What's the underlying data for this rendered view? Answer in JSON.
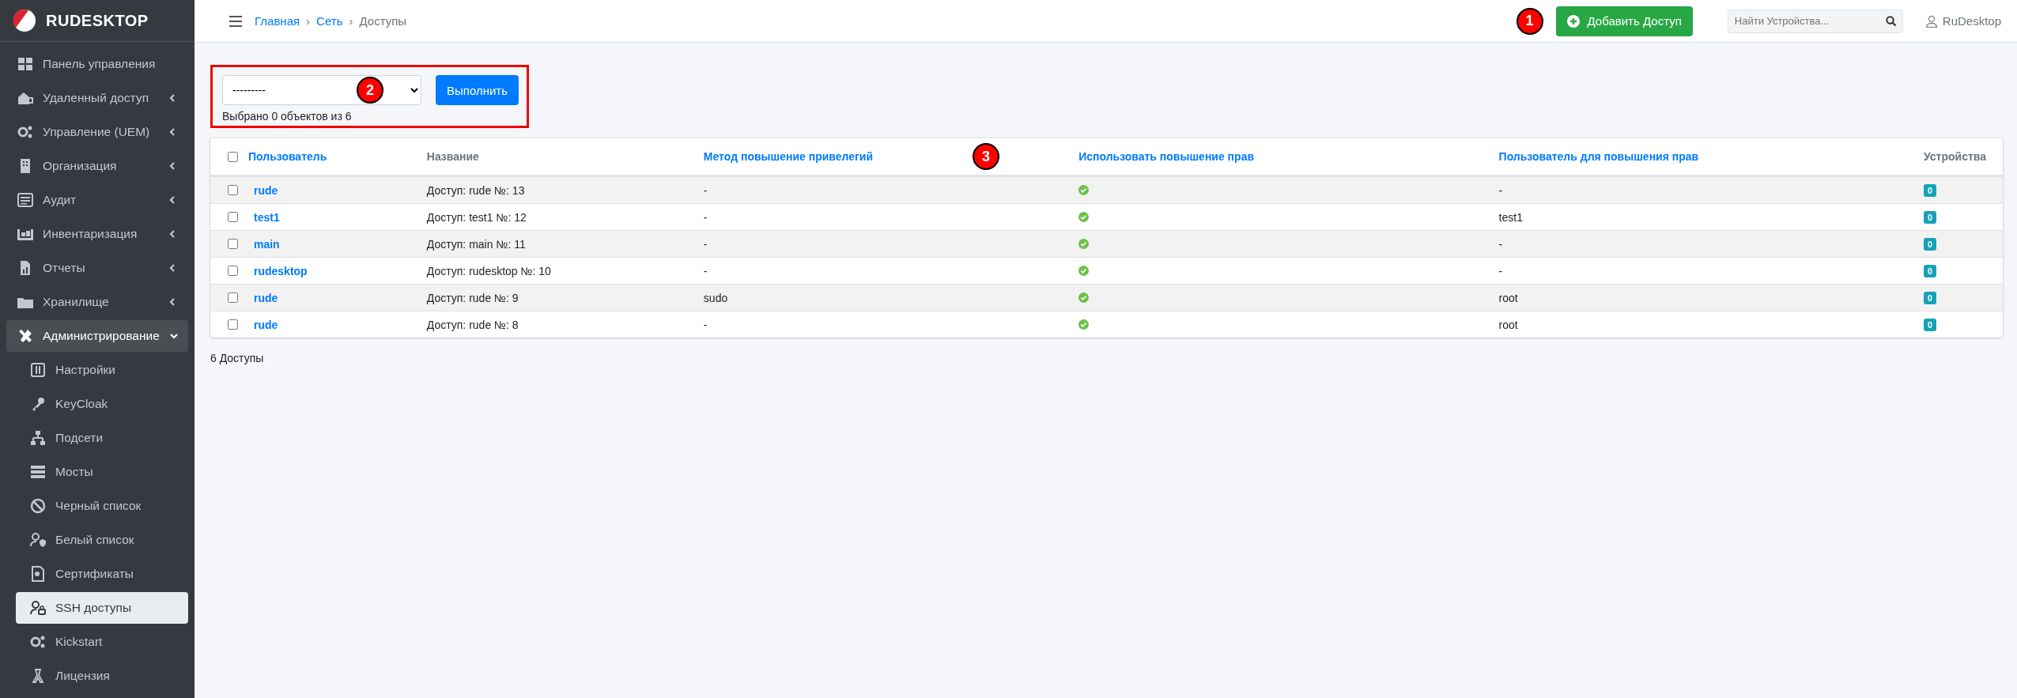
{
  "brand": "RUDESKTOP",
  "sidebar": {
    "items": [
      {
        "label": "Панель управления",
        "has_submenu": false,
        "expanded": false,
        "selected": false
      },
      {
        "label": "Удаленный доступ",
        "has_submenu": true,
        "expanded": false,
        "selected": false
      },
      {
        "label": "Управление (UEM)",
        "has_submenu": true,
        "expanded": false,
        "selected": false
      },
      {
        "label": "Организация",
        "has_submenu": true,
        "expanded": false,
        "selected": false
      },
      {
        "label": "Аудит",
        "has_submenu": true,
        "expanded": false,
        "selected": false
      },
      {
        "label": "Инвентаризация",
        "has_submenu": true,
        "expanded": false,
        "selected": false
      },
      {
        "label": "Отчеты",
        "has_submenu": true,
        "expanded": false,
        "selected": false
      },
      {
        "label": "Хранилище",
        "has_submenu": true,
        "expanded": false,
        "selected": false
      },
      {
        "label": "Администрирование",
        "has_submenu": true,
        "expanded": true,
        "selected": true,
        "children": [
          {
            "label": "Настройки",
            "selected": false
          },
          {
            "label": "KeyCloak",
            "selected": false
          },
          {
            "label": "Подсети",
            "selected": false
          },
          {
            "label": "Мосты",
            "selected": false
          },
          {
            "label": "Черный список",
            "selected": false
          },
          {
            "label": "Белый список",
            "selected": false
          },
          {
            "label": "Сертификаты",
            "selected": false
          },
          {
            "label": "SSH доступы",
            "selected": true
          },
          {
            "label": "Kickstart",
            "selected": false
          },
          {
            "label": "Лицензия",
            "selected": false
          }
        ]
      }
    ]
  },
  "breadcrumb_separator": "›",
  "breadcrumb": [
    {
      "label": "Главная",
      "link": true
    },
    {
      "label": "Сеть",
      "link": true
    },
    {
      "label": "Доступы",
      "link": false
    }
  ],
  "header_actions": {
    "callout": "1",
    "add_button": "Добавить Доступ",
    "search": {
      "placeholder": "Найти Устройства..."
    },
    "user": "RuDesktop"
  },
  "bulk_action": {
    "callout": "2",
    "select_value": "---------",
    "run_button": "Выполнить",
    "selection_info": "Выбрано 0 объектов из 6"
  },
  "table": {
    "callout": "3",
    "header_checked": false,
    "columns": [
      {
        "label": "Пользователь",
        "sortable": true
      },
      {
        "label": "Название",
        "sortable": false
      },
      {
        "label": "Метод повышение привелегий",
        "sortable": true
      },
      {
        "label": "Использовать повышение прав",
        "sortable": true
      },
      {
        "label": "Пользователь для повышения прав",
        "sortable": true
      },
      {
        "label": "Устройства",
        "sortable": false
      }
    ],
    "rows": [
      {
        "checked": false,
        "user": "rude",
        "name": "Доступ: rude №: 13",
        "method": "-",
        "use_elevation": true,
        "elevation_user": "-",
        "devices": "0"
      },
      {
        "checked": false,
        "user": "test1",
        "name": "Доступ: test1 №: 12",
        "method": "-",
        "use_elevation": true,
        "elevation_user": "test1",
        "devices": "0"
      },
      {
        "checked": false,
        "user": "main",
        "name": "Доступ: main №: 11",
        "method": "-",
        "use_elevation": true,
        "elevation_user": "-",
        "devices": "0"
      },
      {
        "checked": false,
        "user": "rudesktop",
        "name": "Доступ: rudesktop №: 10",
        "method": "-",
        "use_elevation": true,
        "elevation_user": "-",
        "devices": "0"
      },
      {
        "checked": false,
        "user": "rude",
        "name": "Доступ: rude №: 9",
        "method": "sudo",
        "use_elevation": true,
        "elevation_user": "root",
        "devices": "0"
      },
      {
        "checked": false,
        "user": "rude",
        "name": "Доступ: rude №: 8",
        "method": "-",
        "use_elevation": true,
        "elevation_user": "root",
        "devices": "0"
      }
    ]
  },
  "footer_count": "6 Доступы"
}
